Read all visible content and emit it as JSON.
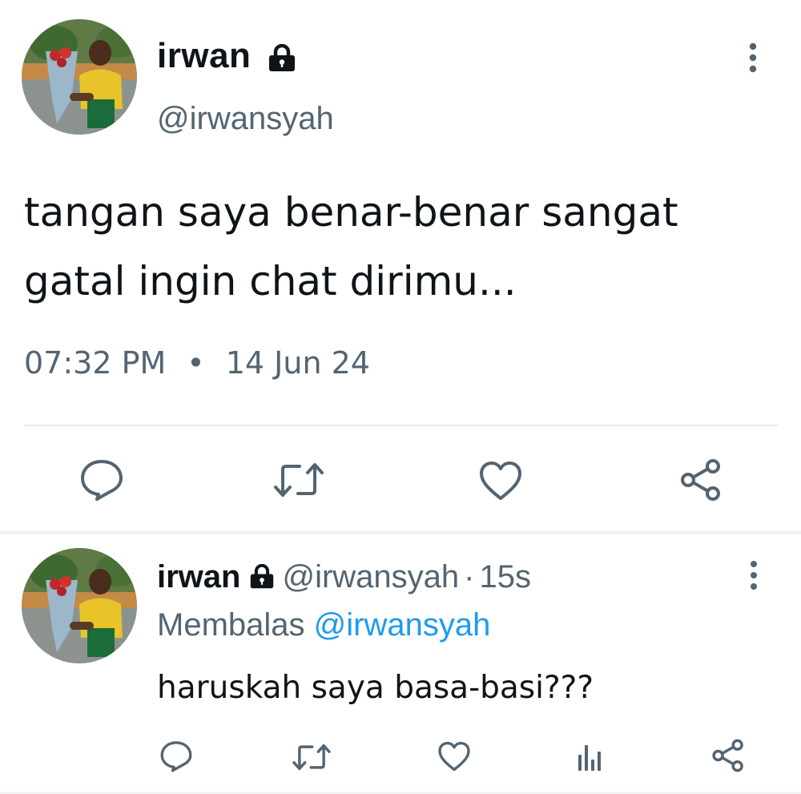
{
  "main_tweet": {
    "display_name": "irwan",
    "handle": "@irwansyah",
    "text": "tangan saya benar-benar sangat\ngatal ingin chat dirimu...",
    "time": "07:32 PM",
    "separator": "•",
    "date": "14 Jun 24",
    "actions": [
      "reply-icon",
      "retweet-icon",
      "like-icon",
      "share-icon"
    ]
  },
  "reply_tweet": {
    "display_name": "irwan",
    "handle": "@irwansyah",
    "dot": "·",
    "age": "15s",
    "replying_prefix": "Membalas",
    "replying_to": "@irwansyah",
    "text": "haruskah saya basa-basi???",
    "actions": [
      "reply-icon",
      "retweet-icon",
      "like-icon",
      "views-icon",
      "share-icon"
    ]
  },
  "colors": {
    "text_primary": "#0f1419",
    "text_secondary": "#536471",
    "accent": "#1d9bf0",
    "icon": "#536471",
    "divider": "#eff3f4"
  }
}
